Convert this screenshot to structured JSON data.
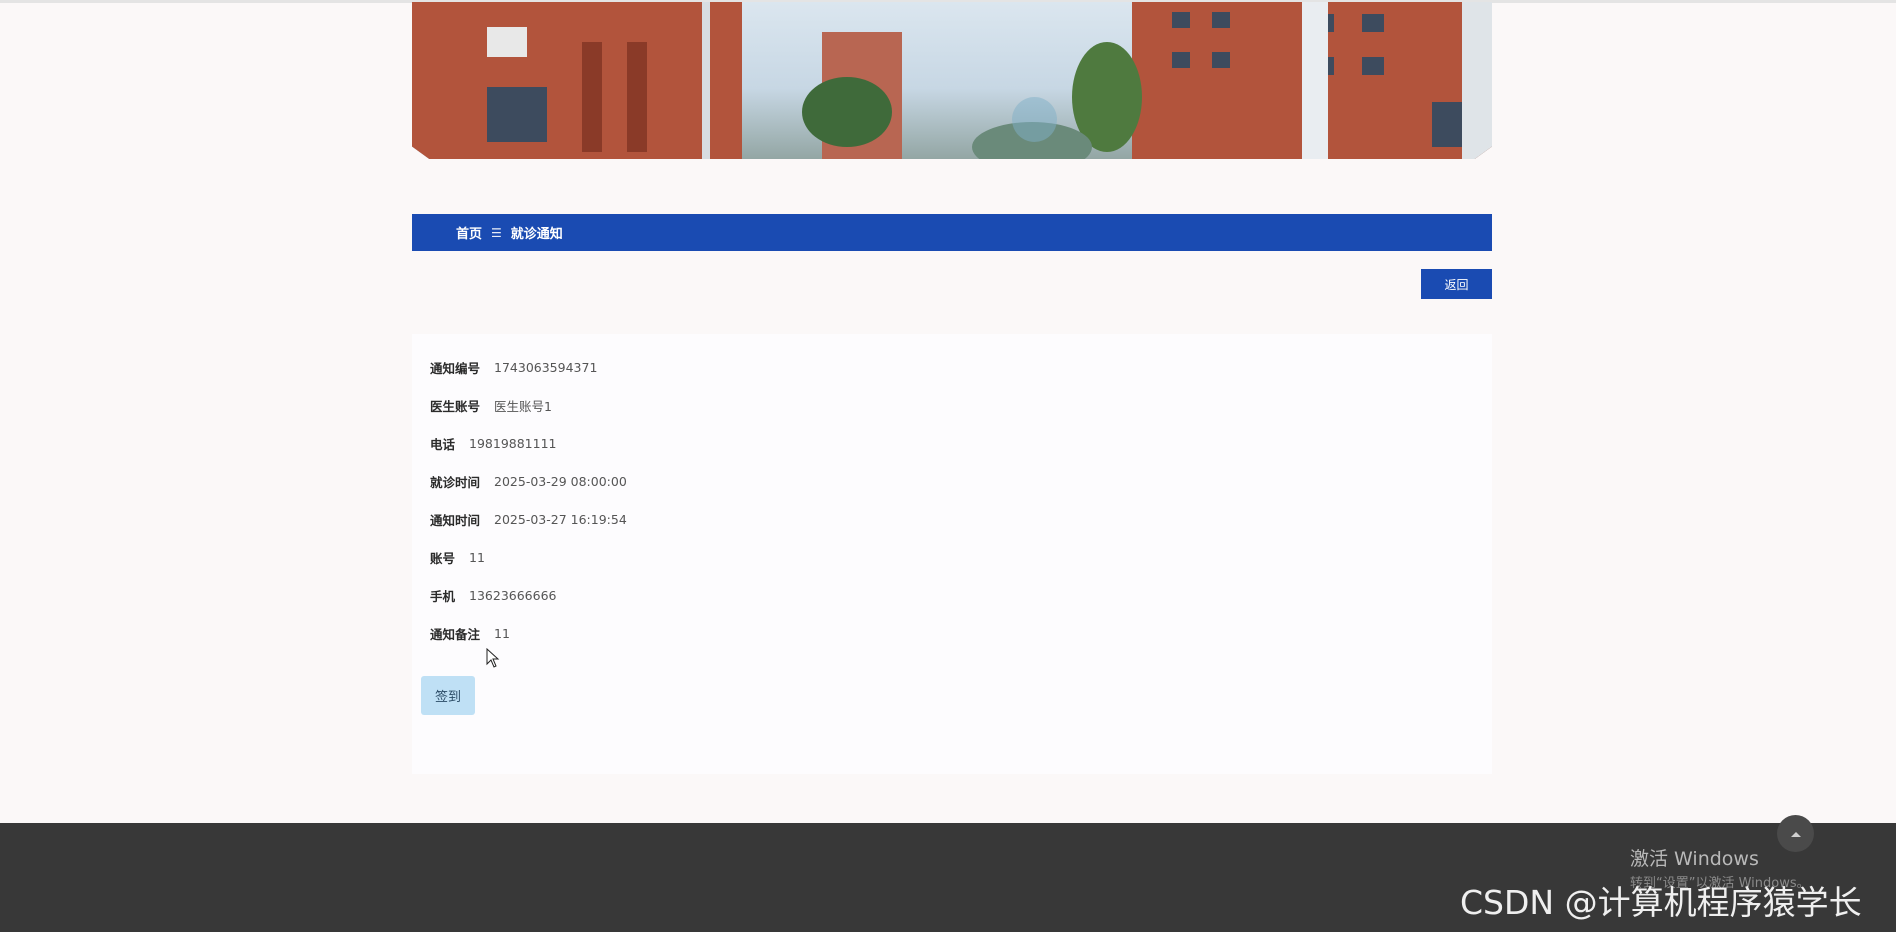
{
  "breadcrumb": {
    "home": "首页",
    "separator": "☰",
    "current": "就诊通知"
  },
  "actions": {
    "back_label": "返回",
    "signin_label": "签到"
  },
  "details": [
    {
      "label": "通知编号",
      "value": "1743063594371"
    },
    {
      "label": "医生账号",
      "value": "医生账号1"
    },
    {
      "label": "电话",
      "value": "19819881111"
    },
    {
      "label": "就诊时间",
      "value": "2025-03-29 08:00:00"
    },
    {
      "label": "通知时间",
      "value": "2025-03-27 16:19:54"
    },
    {
      "label": "账号",
      "value": "11"
    },
    {
      "label": "手机",
      "value": "13623666666"
    },
    {
      "label": "通知备注",
      "value": "11"
    }
  ],
  "watermark": {
    "activate_title": "激活 Windows",
    "activate_hint": "转到“设置”以激活 Windows。",
    "csdn": "CSDN @计算机程序猿学长"
  },
  "colors": {
    "primary": "#1a4bb2",
    "signin_bg": "#bfe0f5",
    "footer_bg": "#383838",
    "page_bg": "#fbf8f8"
  }
}
